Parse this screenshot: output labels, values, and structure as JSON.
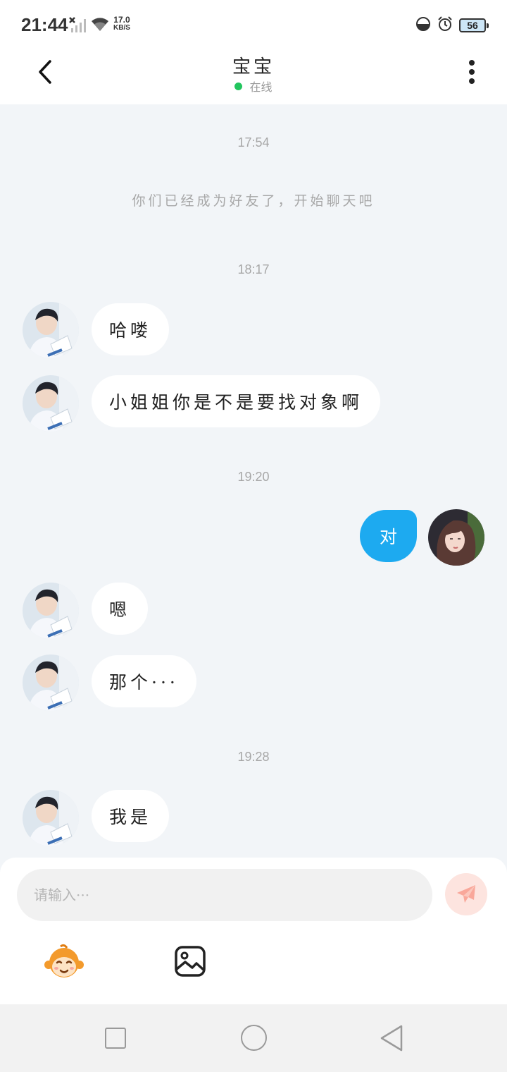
{
  "status_bar": {
    "time": "21:44",
    "net_speed_value": "17.0",
    "net_speed_unit": "KB/S",
    "battery_level": "56",
    "icons": [
      "no-signal-icon",
      "wifi-icon",
      "quiet-mode-icon",
      "alarm-icon",
      "battery-icon"
    ]
  },
  "header": {
    "contact_name": "宝宝",
    "status_text": "在线",
    "status_color": "#22c55e",
    "icons": [
      "back-arrow-icon",
      "more-dots-icon"
    ]
  },
  "chat": {
    "time_1": "17:54",
    "system_message": "你们已经成为好友了，开始聊天吧",
    "time_2": "18:17",
    "messages_1": [
      {
        "sender": "contact",
        "text": "哈喽"
      },
      {
        "sender": "contact",
        "text": "小姐姐你是不是要找对象啊"
      }
    ],
    "time_3": "19:20",
    "messages_2": [
      {
        "sender": "me",
        "text": "对"
      },
      {
        "sender": "contact",
        "text": "嗯"
      },
      {
        "sender": "contact",
        "text": "那个···"
      }
    ],
    "time_4": "19:28",
    "messages_3": [
      {
        "sender": "contact",
        "text": "我是"
      }
    ],
    "colors": {
      "my_bubble": "#1daaf0",
      "contact_bubble": "#ffffff",
      "background": "#f2f5f8"
    }
  },
  "input": {
    "placeholder": "请输入···",
    "value": "",
    "icons": [
      "send-paper-plane-icon",
      "monkey-emoji-icon",
      "image-icon"
    ]
  },
  "nav": {
    "icons": [
      "recent-apps-square-icon",
      "home-circle-icon",
      "back-triangle-icon"
    ]
  }
}
